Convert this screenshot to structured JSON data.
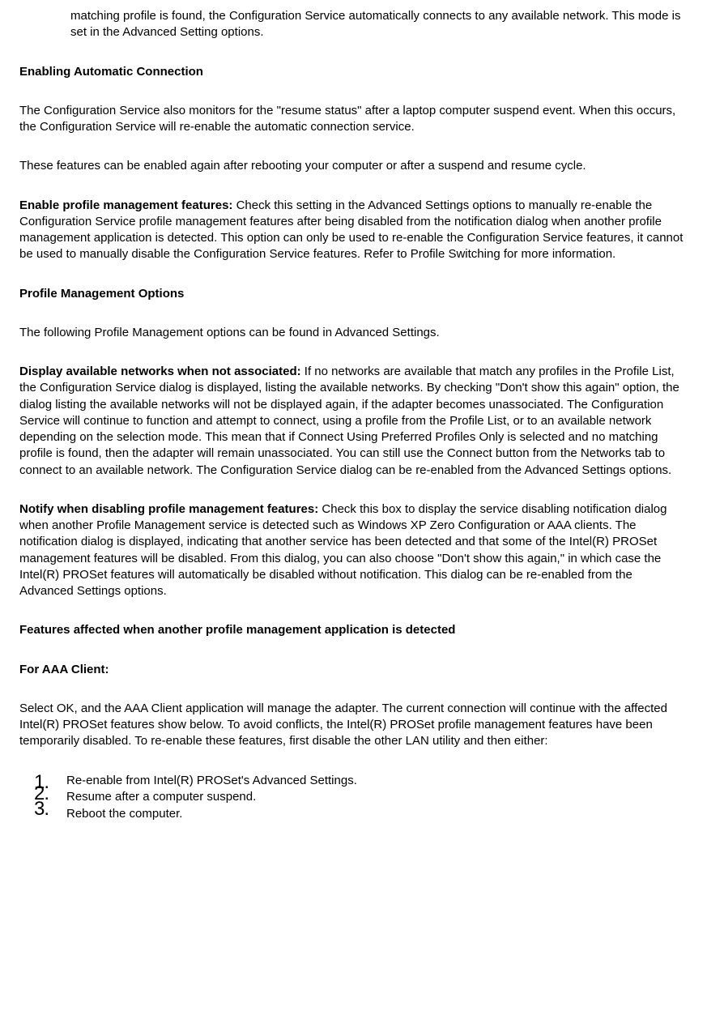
{
  "intro_fragment": "matching profile is found, the Configuration Service automatically connects to any available network. This mode is set in the Advanced Setting options.",
  "heading_enabling": "Enabling Automatic Connection",
  "p_resume": "The Configuration Service also monitors for the \"resume status\" after a laptop computer suspend event. When this occurs, the Configuration Service will re-enable the automatic connection service.",
  "p_reboot": "These features can be enabled again after rebooting your computer or after a suspend and resume cycle.",
  "enable_profile_label": "Enable profile management features:",
  "enable_profile_text": " Check this setting in the Advanced Settings options to manually re-enable the Configuration Service profile management features after being disabled from the notification dialog when another profile management application is detected. This option can only be used to re-enable the Configuration Service features, it cannot be used to manually disable the Configuration Service features. Refer to Profile Switching for more information.",
  "heading_pm_options": "Profile Management Options",
  "p_pm_found": "The following Profile Management options can be found in Advanced Settings.",
  "display_label": "Display available networks when not associated:",
  "display_text": " If no networks are available that match any profiles in the Profile List, the Configuration Service dialog is displayed, listing the available networks. By checking \"Don't show this again\" option, the dialog listing the available networks will not be displayed again, if the adapter becomes unassociated. The Configuration Service will continue to function and attempt to connect, using a profile from the Profile List, or to an available network depending on the selection mode. This mean that if Connect Using Preferred Profiles Only is selected and no matching profile is found, then the adapter will remain unassociated. You can still use the Connect button from the Networks tab to connect to an available network. The Configuration Service dialog can be re-enabled from the Advanced Settings options.",
  "notify_label": "Notify when disabling profile management features:",
  "notify_text": " Check this box to display the service disabling notification dialog when another Profile Management service is detected such as Windows XP Zero Configuration or AAA clients. The notification dialog is displayed, indicating that another service has been detected and that some of the Intel(R) PROSet management features will be disabled. From this dialog, you can also choose \"Don't show this again,\" in which case the Intel(R) PROSet features will automatically be disabled without notification. This dialog can be re-enabled from the Advanced Settings options.",
  "heading_features": "Features affected when another profile management application is detected",
  "heading_aaa": "For AAA Client:",
  "p_aaa": "Select OK, and the AAA Client application will manage the adapter. The current connection will continue with the affected Intel(R) PROSet features show below. To avoid conflicts, the Intel(R) PROSet profile management features have been temporarily disabled. To re-enable these features, first disable the other LAN utility and then either:",
  "list": {
    "n1": "1.",
    "t1": "Re-enable from Intel(R) PROSet's Advanced Settings.",
    "n2": "2.",
    "t2": "Resume after a computer suspend.",
    "n3": "3.",
    "t3": "Reboot the computer."
  }
}
